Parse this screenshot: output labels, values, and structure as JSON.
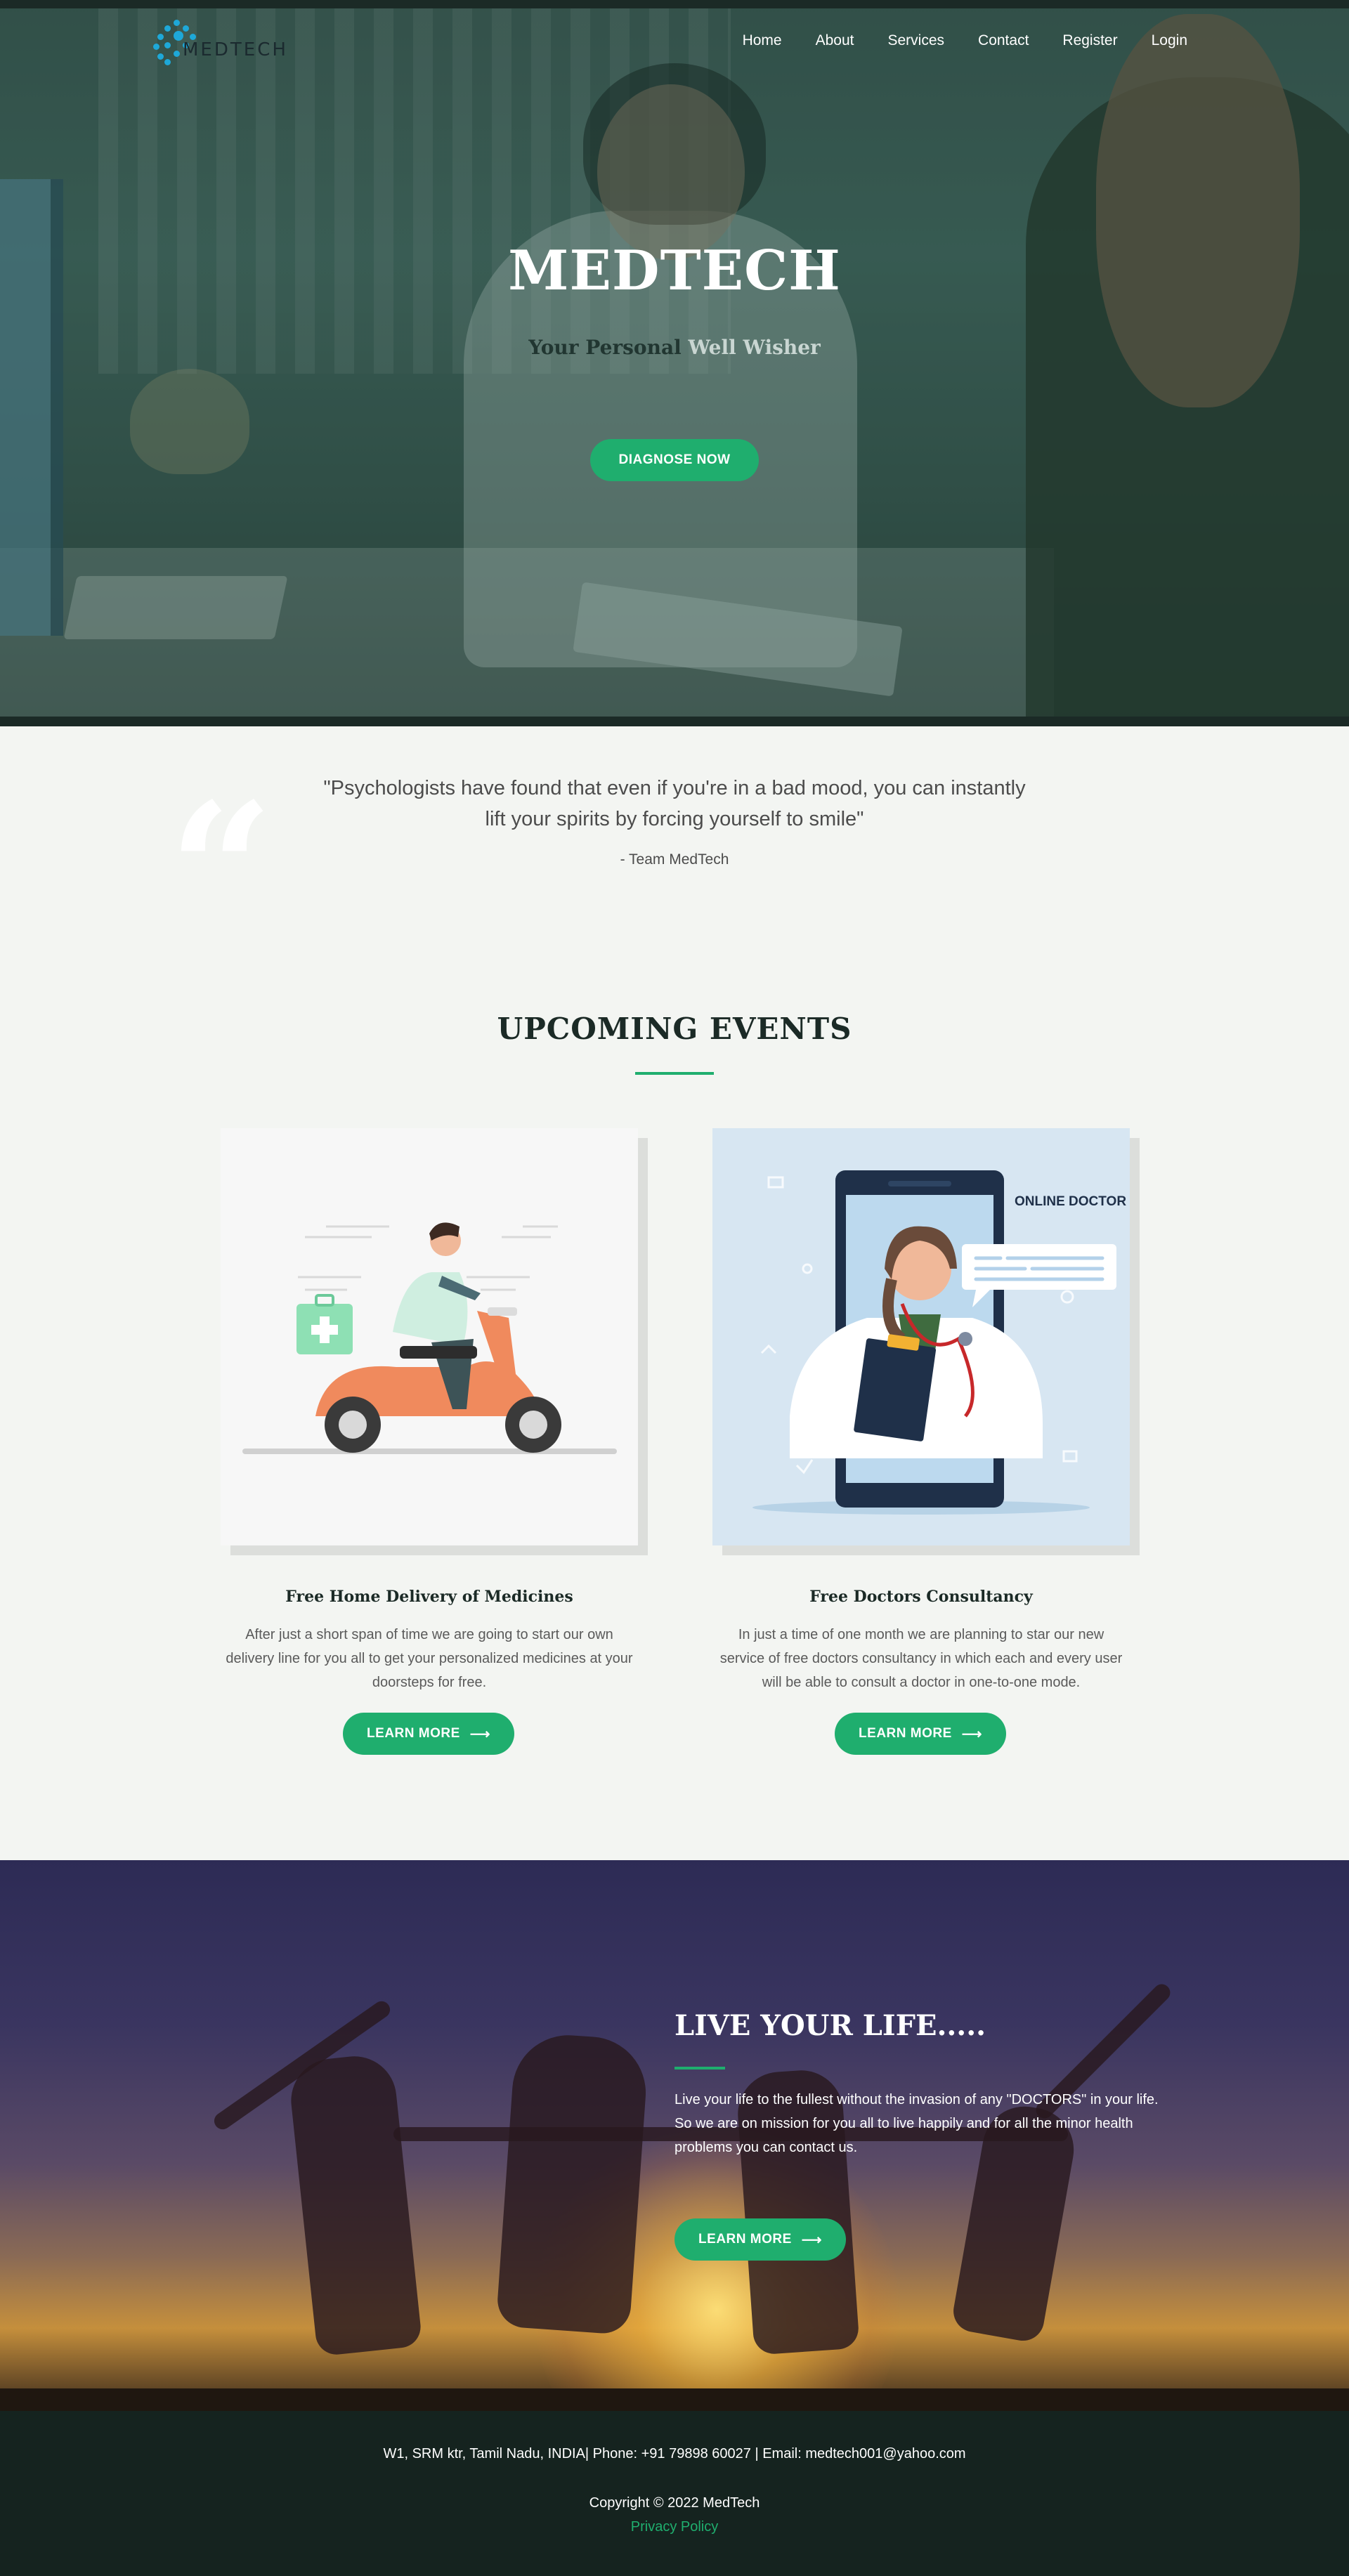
{
  "brand": {
    "logo_text": "MEDTECH",
    "accent": "#1fae6e",
    "logo_color": "#1ea8d8"
  },
  "nav": {
    "items": [
      "Home",
      "About",
      "Services",
      "Contact",
      "Register",
      "Login"
    ]
  },
  "hero": {
    "title": "MEDTECH",
    "subtitle_dark": "Your Personal",
    "subtitle_light": "Well Wisher",
    "cta": "DIAGNOSE NOW"
  },
  "quote": {
    "mark": "“",
    "text": "\"Psychologists have found that even if you're in a bad mood, you can instantly lift your spirits by forcing yourself to smile\"",
    "author": "- Team MedTech"
  },
  "events": {
    "title": "UPCOMING EVENTS",
    "cards": [
      {
        "image_icon": "scooter-delivery-illustration",
        "title": "Free Home Delivery of Medicines",
        "description": "After just a short span of time we are going to start our own delivery line for you all to get your personalized medicines at your doorsteps for free.",
        "button": "LEARN MORE"
      },
      {
        "image_icon": "online-doctor-illustration",
        "image_label": "ONLINE DOCTOR",
        "title": "Free Doctors Consultancy",
        "description": "In just a time of one month we are planning to star our new service of free doctors consultancy in which each and every user will be able to consult a doctor in one-to-one mode.",
        "button": "LEARN MORE"
      }
    ]
  },
  "live": {
    "title": "LIVE YOUR LIFE.....",
    "text": "Live your life to the fullest without the invasion of any \"DOCTORS\" in your life. So we are on mission for you all to live happily and for all the minor health problems you can contact us.",
    "button": "LEARN MORE"
  },
  "footer": {
    "info": "W1, SRM ktr, Tamil Nadu, INDIA| Phone: +91 79898 60027 | Email: medtech001@yahoo.com",
    "copyright": "Copyright © 2022 MedTech",
    "privacy": "Privacy Policy"
  }
}
